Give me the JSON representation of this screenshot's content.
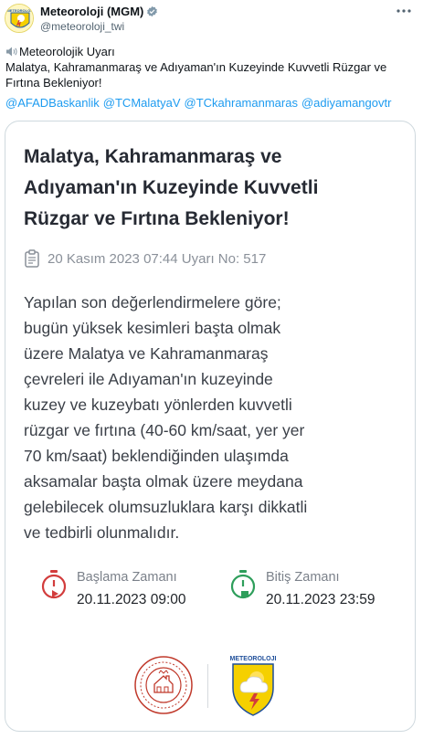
{
  "account": {
    "display_name": "Meteoroloji (MGM)",
    "handle": "@meteoroloji_twi",
    "verified": true,
    "avatar_text": "METEOROLOJI"
  },
  "tweet": {
    "lines": [
      "Meteorolojik Uyarı",
      "Malatya, Kahramanmaraş ve Adıyaman'ın Kuzeyinde Kuvvetli Rüzgar ve",
      "Fırtına Bekleniyor!"
    ],
    "mentions": [
      "@AFADBaskanlik",
      "@TCMalatyaV",
      "@TCkahramanmaras",
      "@adiyamangovtr"
    ]
  },
  "card": {
    "title_lines": [
      "Malatya, Kahramanmaraş ve",
      "Adıyaman'ın Kuzeyinde Kuvvetli",
      "Rüzgar ve Fırtına Bekleniyor!"
    ],
    "meta": "20 Kasım 2023 07:44 Uyarı No: 517",
    "body_lines": [
      "Yapılan son değerlendirmelere göre;",
      "bugün yüksek kesimleri başta olmak",
      "üzere Malatya ve Kahramanmaraş",
      "çevreleri ile Adıyaman'ın kuzeyinde",
      "kuzey ve kuzeybatı yönlerden kuvvetli",
      "rüzgar ve fırtına (40-60 km/saat, yer yer",
      "70 km/saat) beklendiğinden ulaşımda",
      "aksamalar başta olmak üzere meydana",
      "gelebilecek olumsuzluklara karşı dikkatli",
      "ve tedbirli olunmalıdır."
    ],
    "start": {
      "label": "Başlama Zamanı",
      "value": "20.11.2023 09:00"
    },
    "end": {
      "label": "Bitiş Zamanı",
      "value": "20.11.2023 23:59"
    },
    "mgm_logo_text": "METEOROLOJI"
  },
  "colors": {
    "link": "#1d9bf0",
    "verified": "#829aab",
    "start_icon": "#d23c3c",
    "end_icon": "#2e9e5b",
    "mgm_yellow": "#f5d000"
  },
  "icons": [
    "more-icon",
    "verified-badge-icon",
    "speaker-icon",
    "clipboard-icon",
    "stopwatch-icon"
  ]
}
